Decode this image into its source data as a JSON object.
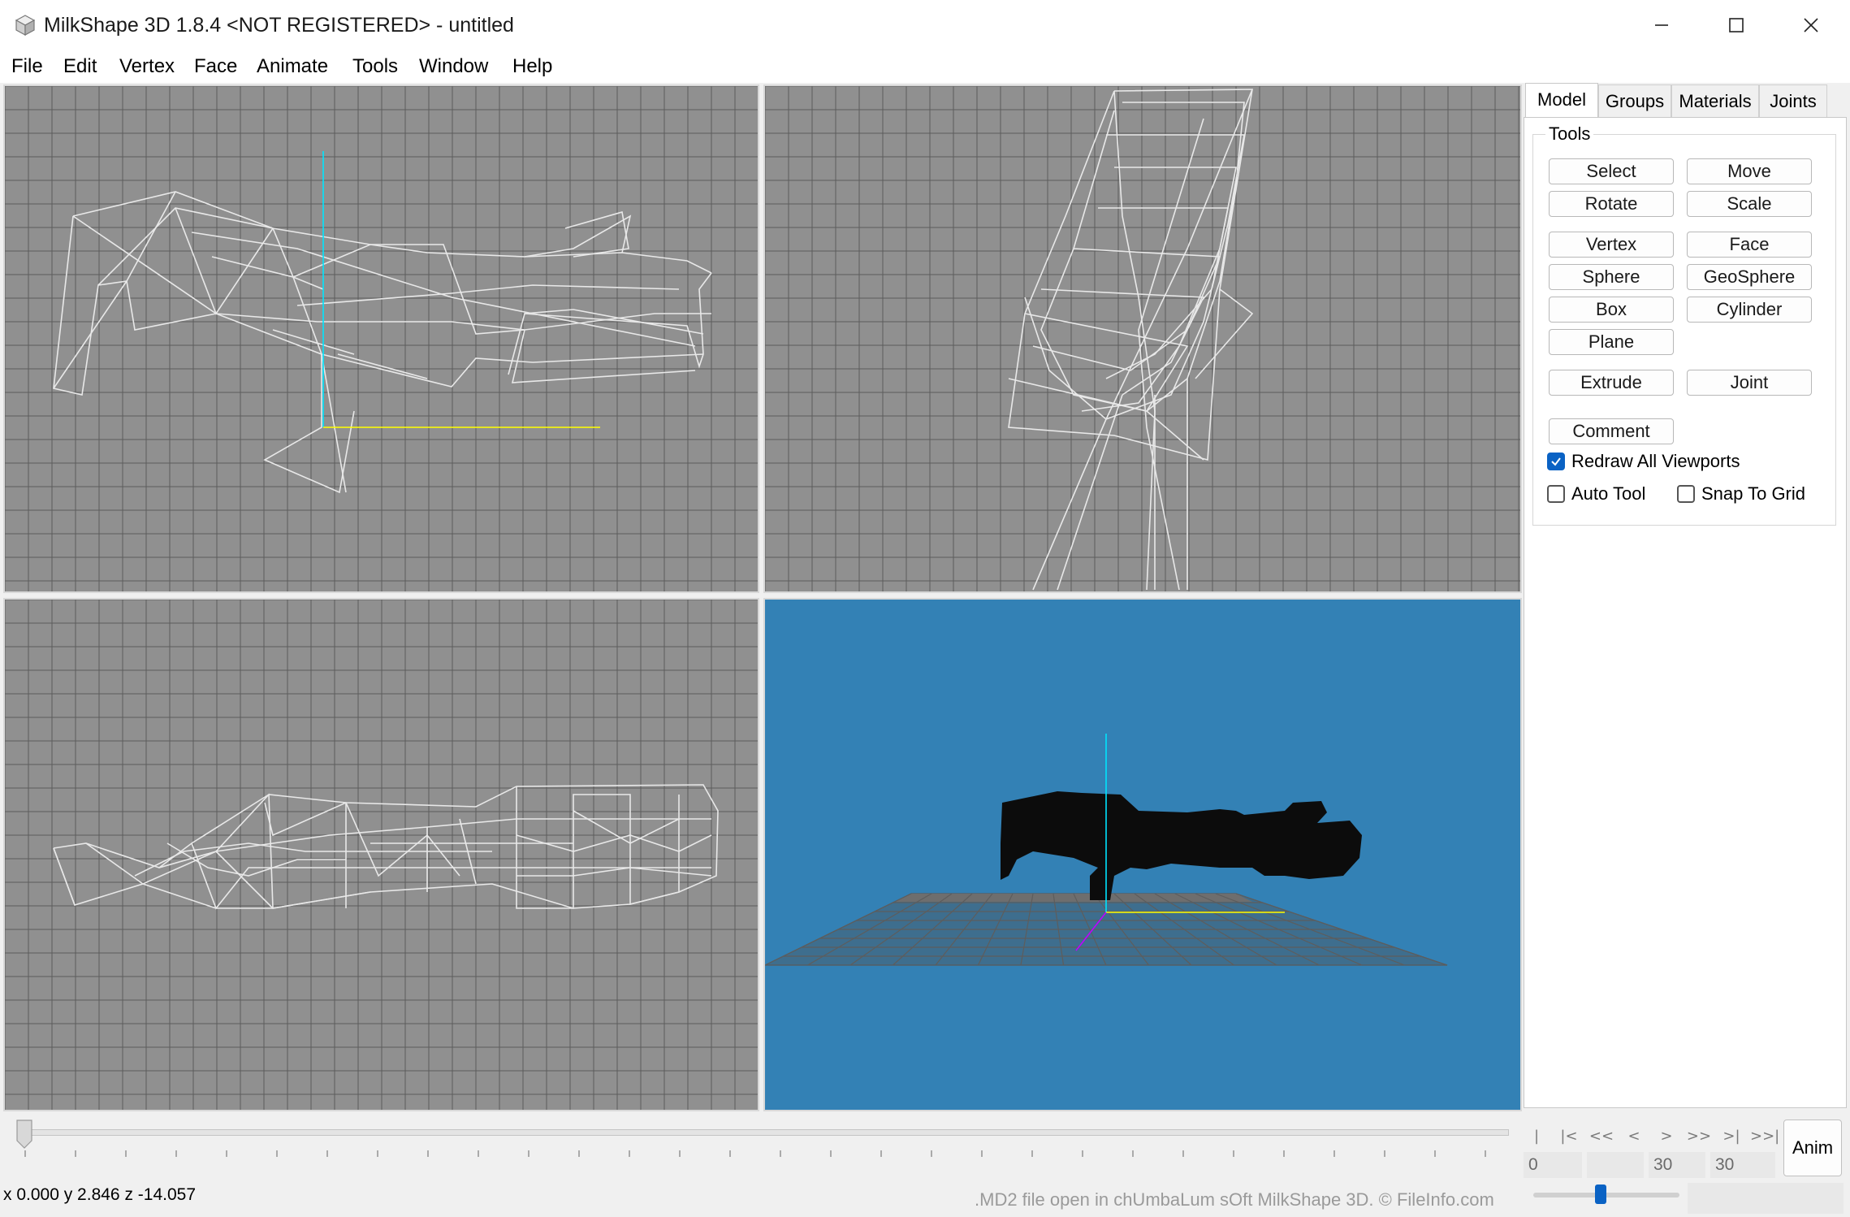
{
  "window": {
    "title": "MilkShape 3D 1.8.4 <NOT REGISTERED> - untitled"
  },
  "menu": {
    "items": [
      {
        "label": "File"
      },
      {
        "label": "Edit"
      },
      {
        "label": "Vertex"
      },
      {
        "label": "Face"
      },
      {
        "label": "Animate"
      },
      {
        "label": "Tools"
      },
      {
        "label": "Window"
      },
      {
        "label": "Help"
      }
    ]
  },
  "panel": {
    "tabs": [
      {
        "label": "Model",
        "active": true
      },
      {
        "label": "Groups",
        "active": false
      },
      {
        "label": "Materials",
        "active": false
      },
      {
        "label": "Joints",
        "active": false
      }
    ],
    "group_title": "Tools",
    "buttons": {
      "select": "Select",
      "move": "Move",
      "rotate": "Rotate",
      "scale": "Scale",
      "vertex": "Vertex",
      "face": "Face",
      "sphere": "Sphere",
      "geosphere": "GeoSphere",
      "box": "Box",
      "cylinder": "Cylinder",
      "plane": "Plane",
      "extrude": "Extrude",
      "joint": "Joint",
      "comment": "Comment"
    },
    "checkboxes": {
      "redraw_all": {
        "label": "Redraw All Viewports",
        "checked": true
      },
      "auto_tool": {
        "label": "Auto Tool",
        "checked": false
      },
      "snap_to_grid": {
        "label": "Snap To Grid",
        "checked": false
      }
    }
  },
  "animation": {
    "anim_label": "Anim",
    "frame_current": "0",
    "frame_field_2": "",
    "frame_field_3": "30",
    "frame_field_4": "30",
    "playback_buttons": [
      "|<<",
      "|<",
      "<<",
      "<",
      ">",
      ">>",
      ">|",
      ">>|"
    ]
  },
  "status": {
    "coords": "x 0.000 y 2.846 z -14.057",
    "note": ".MD2 file open in chUmbaLum sOft MilkShape 3D. © FileInfo.com"
  },
  "colors": {
    "viewport_bg": "#909090",
    "grid_line": "#5c5c5c",
    "wire": "#e8e8e8",
    "perspective_bg": "#3381b5",
    "axis_cyan": "#00e5ff",
    "axis_yellow": "#ffff00",
    "checkbox_blue": "#0a62c4"
  }
}
